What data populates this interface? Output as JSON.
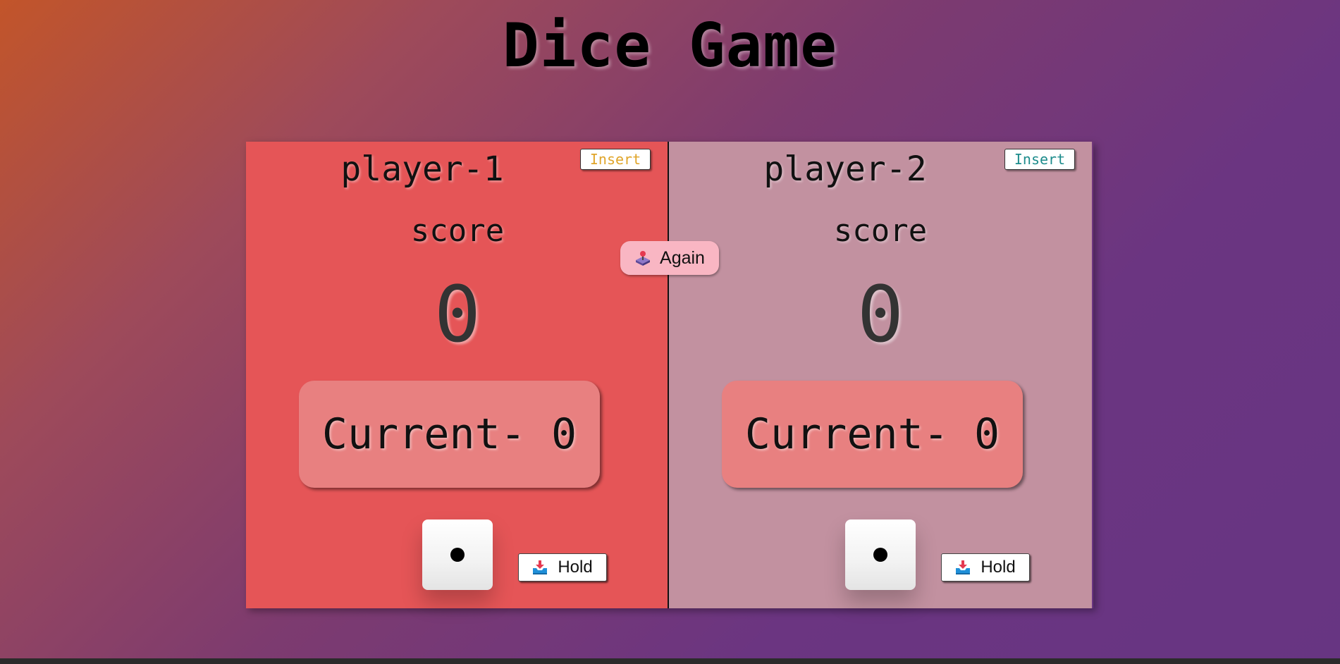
{
  "title": "Dice Game",
  "again_button": {
    "label": "Again",
    "icon": "joystick-icon"
  },
  "players": [
    {
      "name": "player-1",
      "insert_label": "Insert",
      "score_label": "score",
      "score": "0",
      "current_label": "Current- 0",
      "dice_value": 1,
      "hold_label": "Hold",
      "hold_icon": "inbox-tray-icon",
      "background_color": "#e55557"
    },
    {
      "name": "player-2",
      "insert_label": "Insert",
      "score_label": "score",
      "score": "0",
      "current_label": "Current- 0",
      "dice_value": 1,
      "hold_label": "Hold",
      "hold_icon": "inbox-tray-icon",
      "background_color": "#c291a0"
    }
  ],
  "colors": {
    "insert_player_1": "#e0a52a",
    "insert_player_2": "#1d8c8c",
    "again_button_bg": "#f9b6c3"
  }
}
